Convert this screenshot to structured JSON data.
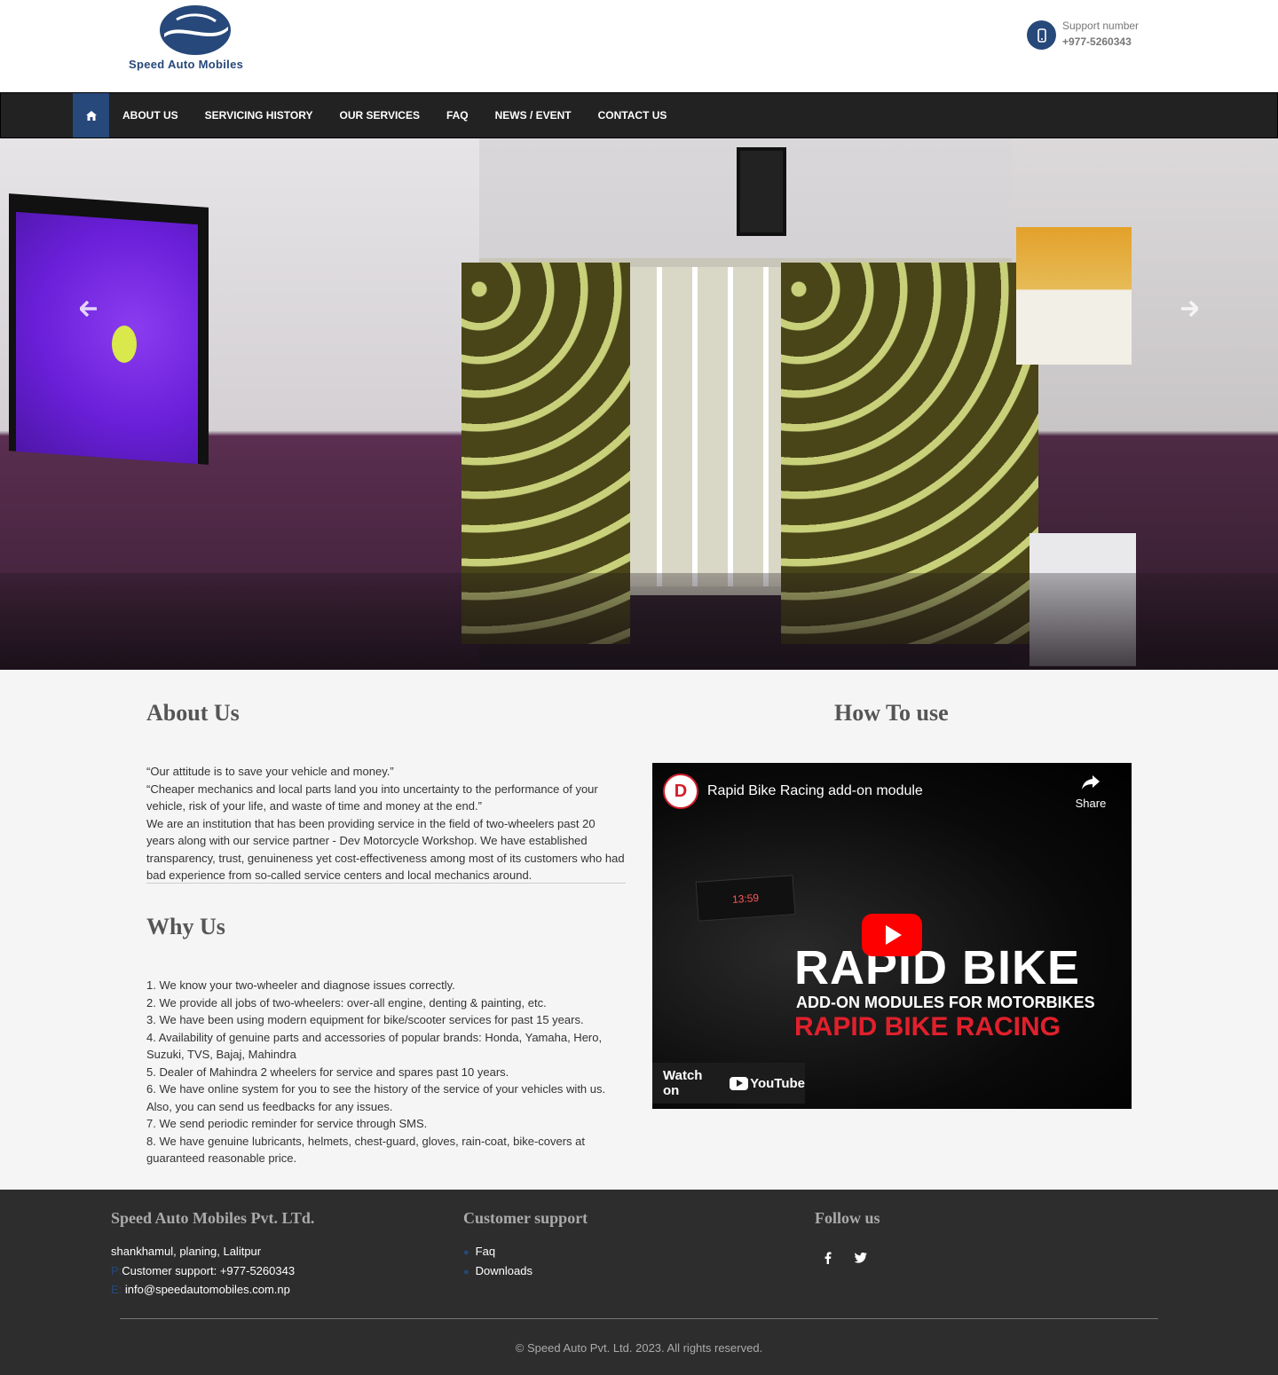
{
  "colors": {
    "brand": "#27487a",
    "nav_bg": "#222222",
    "footer_bg": "#2d2d2d",
    "content_bg": "#f5f5f5"
  },
  "header": {
    "logo_text": "Speed Auto Mobiles",
    "support_label": "Support number",
    "support_number": "+977-5260343",
    "support_icon": "phone-icon"
  },
  "nav": {
    "home_icon": "home-icon",
    "items": [
      "ABOUT US",
      "SERVICING HISTORY",
      "OUR SERVICES",
      "FAQ",
      "NEWS / EVENT",
      "CONTACT US"
    ]
  },
  "hero": {
    "prev_icon": "arrow-left-icon",
    "next_icon": "arrow-right-icon"
  },
  "about": {
    "title": "About Us",
    "paragraphs": [
      "“Our attitude is to save your vehicle and money.”",
      "“Cheaper mechanics and local parts land you into uncertainty to the performance of your vehicle, risk of your life, and waste of time and money at the end.”",
      "We are an institution that has been providing service in the field of two-wheelers past 20 years along with our service partner - Dev Motorcycle Workshop. We have established transparency, trust, genuineness yet cost-effectiveness among most of its customers who had bad experience from so-called service centers and local mechanics around."
    ]
  },
  "why": {
    "title": "Why Us",
    "items": [
      "1. We know your two-wheeler and diagnose issues correctly.",
      "2. We provide all jobs of two-wheelers: over-all engine, denting & painting, etc.",
      "3. We have been using modern equipment for bike/scooter services for past 15 years.",
      "4. Availability of genuine parts and accessories of popular brands: Honda, Yamaha, Hero, Suzuki, TVS, Bajaj, Mahindra",
      "5. Dealer of Mahindra 2 wheelers for service and spares past 10 years.",
      "6. We have online system for you to see the history of the service of your vehicles with us. Also, you can send us feedbacks for any issues.",
      "7. We send periodic reminder for service through SMS.",
      "8. We have genuine lubricants, helmets, chest-guard, gloves, rain-coat, bike-covers at guaranteed reasonable price."
    ]
  },
  "how": {
    "title": "How To use",
    "video": {
      "title": "Rapid Bike Racing add-on module",
      "share_label": "Share",
      "headline": "RAPID BIKE",
      "subline": "ADD-ON MODULES FOR MOTORBIKES",
      "brandline": "RAPID BIKE RACING",
      "watch_on": "Watch on",
      "platform": "YouTube"
    }
  },
  "footer": {
    "company_title": "Speed Auto Mobiles Pvt. LTd.",
    "address": "shankhamul, planing, Lalitpur",
    "phone_prefix": "P:",
    "phone": "Customer support: +977-5260343",
    "email_prefix": "E:",
    "email": "info@speedautomobiles.com.np",
    "support_title": "Customer support",
    "support_links": [
      "Faq",
      "Downloads"
    ],
    "follow_title": "Follow us",
    "social": [
      "facebook-icon",
      "twitter-icon"
    ],
    "copyright": "© Speed Auto Pvt. Ltd. 2023. All rights reserved."
  }
}
